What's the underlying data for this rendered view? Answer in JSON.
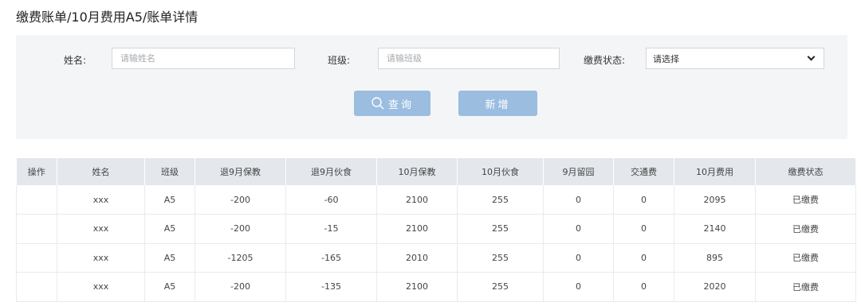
{
  "breadcrumb": "缴费账单/10月费用A5/账单详情",
  "filters": {
    "name_label": "姓名:",
    "name_placeholder": "请输姓名",
    "class_label": "班级:",
    "class_placeholder": "请输班级",
    "status_label": "缴费状态:",
    "status_value": "请选择"
  },
  "buttons": {
    "query": "查询",
    "add": "新增"
  },
  "table": {
    "columns": [
      "操作",
      "姓名",
      "班级",
      "退9月保教",
      "退9月伙食",
      "10月保教",
      "10月伙食",
      "9月留园",
      "交通费",
      "10月费用",
      "缴费状态"
    ],
    "rows": [
      [
        "",
        "xxx",
        "A5",
        "-200",
        "-60",
        "2100",
        "255",
        "0",
        "0",
        "2095",
        "已缴费"
      ],
      [
        "",
        "xxx",
        "A5",
        "-200",
        "-15",
        "2100",
        "255",
        "0",
        "0",
        "2140",
        "已缴费"
      ],
      [
        "",
        "xxx",
        "A5",
        "-1205",
        "-165",
        "2010",
        "255",
        "0",
        "0",
        "895",
        "已缴费"
      ],
      [
        "",
        "xxx",
        "A5",
        "-200",
        "-135",
        "2100",
        "255",
        "0",
        "0",
        "2020",
        "已缴费"
      ]
    ]
  }
}
